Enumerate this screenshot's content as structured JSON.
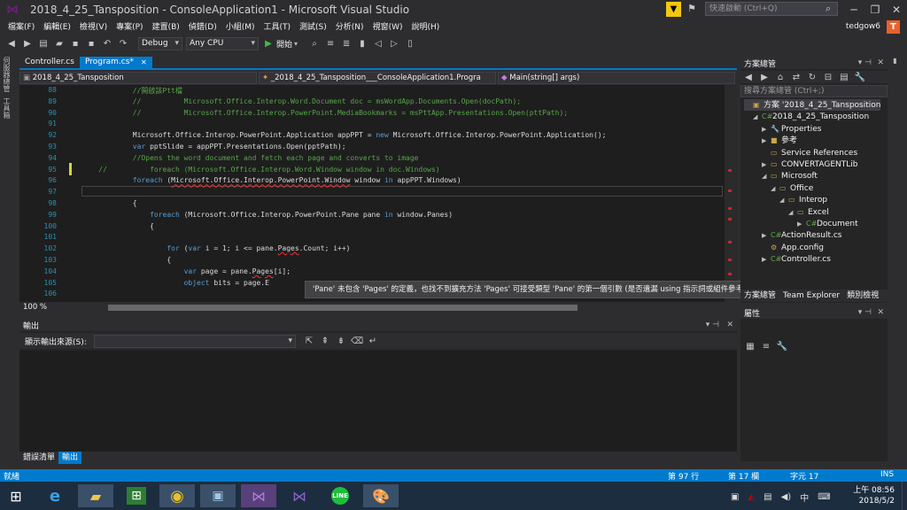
{
  "title": {
    "text": "2018_4_25_Tansposition - ConsoleApplication1 - Microsoft Visual Studio",
    "quick_launch_placeholder": "快速啟動 (Ctrl+Q)",
    "user": "tedgow6",
    "avatar_letter": "T"
  },
  "menu": [
    "檔案(F)",
    "編輯(E)",
    "檢視(V)",
    "專案(P)",
    "建置(B)",
    "偵錯(D)",
    "小組(M)",
    "工具(T)",
    "測試(S)",
    "分析(N)",
    "視窗(W)",
    "說明(H)"
  ],
  "toolbar": {
    "config": "Debug",
    "platform": "Any CPU",
    "start": "開始"
  },
  "left_tabs": [
    "伺服器總管",
    "工具箱"
  ],
  "doc_tabs": [
    {
      "label": "Controller.cs"
    },
    {
      "label": "Program.cs*",
      "close": "✕"
    }
  ],
  "nav": {
    "project": "2018_4_25_Tansposition",
    "class": "_2018_4_25_Tansposition___ConsoleApplication1.Progra",
    "method": "Main(string[] args)"
  },
  "code_lines": [
    {
      "n": "88",
      "t": "            //開啟該Ptt檔"
    },
    {
      "n": "89",
      "t": "            //          Microsoft.Office.Interop.Word.Document doc = msWordApp.Documents.Open(docPath);"
    },
    {
      "n": "90",
      "t": "            //          Microsoft.Office.Interop.PowerPoint.MediaBookmarks = msPttApp.Presentations.Open(pttPath);"
    },
    {
      "n": "91",
      "t": ""
    },
    {
      "n": "92",
      "t": "            Microsoft.Office.Interop.PowerPoint.Application appPPT = new Microsoft.Office.Interop.PowerPoint.Application();"
    },
    {
      "n": "93",
      "t": "            var pptSlide = appPPT.Presentations.Open(pptPath);"
    },
    {
      "n": "94",
      "t": "            //Opens the word document and fetch each page and converts to image"
    },
    {
      "n": "95",
      "t": "    //          foreach (Microsoft.Office.Interop.Word.Window window in doc.Windows)"
    },
    {
      "n": "96",
      "t": "            foreach (Microsoft.Office.Interop.PowerPoint.Window window in appPPT.Windows)"
    },
    {
      "n": "97",
      "t": ""
    },
    {
      "n": "98",
      "t": "            {"
    },
    {
      "n": "99",
      "t": "                foreach (Microsoft.Office.Interop.PowerPoint.Pane pane in window.Panes)"
    },
    {
      "n": "100",
      "t": "                {"
    },
    {
      "n": "101",
      "t": ""
    },
    {
      "n": "102",
      "t": "                    for (var i = 1; i <= pane.Pages.Count; i++)"
    },
    {
      "n": "103",
      "t": "                    {"
    },
    {
      "n": "104",
      "t": "                        var page = pane.Pages[i];"
    },
    {
      "n": "105",
      "t": "                        object bits = page.E"
    },
    {
      "n": "106",
      "t": ""
    }
  ],
  "tooltip": "'Pane' 未包含 'Pages' 的定義，也找不到擴充方法 'Pages' 可接受類型 'Pane' 的第一個引數 (是否遺漏 using 指示詞或組件參考?)",
  "zoom": "100 %",
  "output": {
    "title": "輸出",
    "source_label": "顯示輸出來源(S):",
    "tabs": [
      "錯誤清單",
      "輸出"
    ]
  },
  "solution_explorer": {
    "title": "方案總管",
    "search_placeholder": "搜尋方案總管 (Ctrl+;)",
    "nodes": [
      {
        "label": "方案 '2018_4_25_Tansposition",
        "depth": 0,
        "tw": "",
        "icon": "▣"
      },
      {
        "label": "2018_4_25_Tansposition",
        "depth": 1,
        "tw": "◢",
        "icon": "C#"
      },
      {
        "label": "Properties",
        "depth": 2,
        "tw": "▶",
        "icon": "🔧"
      },
      {
        "label": "參考",
        "depth": 2,
        "tw": "▶",
        "icon": "■"
      },
      {
        "label": "Service References",
        "depth": 2,
        "tw": "",
        "icon": "▭"
      },
      {
        "label": "CONVERTAGENTLib",
        "depth": 2,
        "tw": "▶",
        "icon": "▭"
      },
      {
        "label": "Microsoft",
        "depth": 2,
        "tw": "◢",
        "icon": "▭"
      },
      {
        "label": "Office",
        "depth": 3,
        "tw": "◢",
        "icon": "▭"
      },
      {
        "label": "Interop",
        "depth": 4,
        "tw": "◢",
        "icon": "▭"
      },
      {
        "label": "Excel",
        "depth": 5,
        "tw": "◢",
        "icon": "▭"
      },
      {
        "label": "Document",
        "depth": 6,
        "tw": "▶",
        "icon": "C#"
      },
      {
        "label": "ActionResult.cs",
        "depth": 2,
        "tw": "▶",
        "icon": "C#"
      },
      {
        "label": "App.config",
        "depth": 2,
        "tw": "",
        "icon": "⚙"
      },
      {
        "label": "Controller.cs",
        "depth": 2,
        "tw": "▶",
        "icon": "C#"
      }
    ],
    "tabs": [
      "方案總管",
      "Team Explorer",
      "類別檢視"
    ]
  },
  "properties": {
    "title": "屬性"
  },
  "status": {
    "ready": "就緒",
    "line": "第 97 行",
    "col": "第 17 欄",
    "char": "字元 17",
    "mode": "INS"
  },
  "taskbar": {
    "time": "上午 08:56",
    "date": "2018/5/2",
    "ime": "中"
  },
  "colors": {
    "accent": "#007acc",
    "error": "#c4262c",
    "background": "#2d2d30"
  }
}
